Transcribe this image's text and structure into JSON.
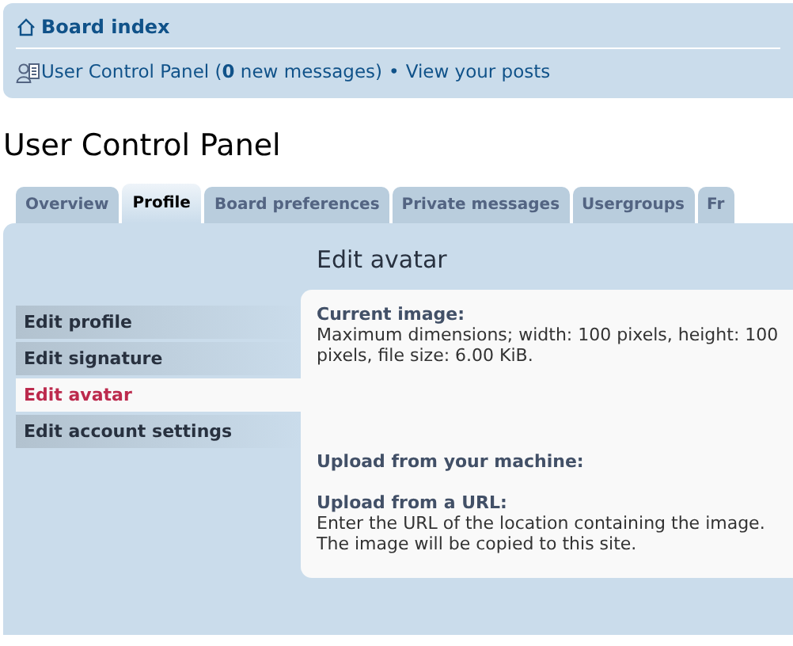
{
  "breadcrumb": {
    "label": "Board index"
  },
  "user_links": {
    "panel_link": "User Control Panel (**0** new messages)",
    "separator": "•",
    "posts_link": "View your posts"
  },
  "page_title": "User Control Panel",
  "tabs": [
    {
      "label": "Overview",
      "selected": false
    },
    {
      "label": "Profile",
      "selected": true
    },
    {
      "label": "Board preferences",
      "selected": false
    },
    {
      "label": "Private messages",
      "selected": false
    },
    {
      "label": "Usergroups",
      "selected": false
    },
    {
      "label": "Fr",
      "selected": false
    }
  ],
  "section_title": "Edit avatar",
  "menu": [
    {
      "label": "Edit profile",
      "selected": false
    },
    {
      "label": "Edit signature",
      "selected": false
    },
    {
      "label": "Edit avatar",
      "selected": true
    },
    {
      "label": "Edit account settings",
      "selected": false
    }
  ],
  "fields": [
    {
      "title": "Current image:",
      "description": "Maximum dimensions; width: 100 pixels, height: 100 pixels, file size: 6.00 KiB."
    },
    {
      "title": "Upload from your machine:"
    },
    {
      "title": "Upload from a URL:",
      "description": "Enter the URL of the location containing the image. The image will be copied to this site."
    }
  ]
}
